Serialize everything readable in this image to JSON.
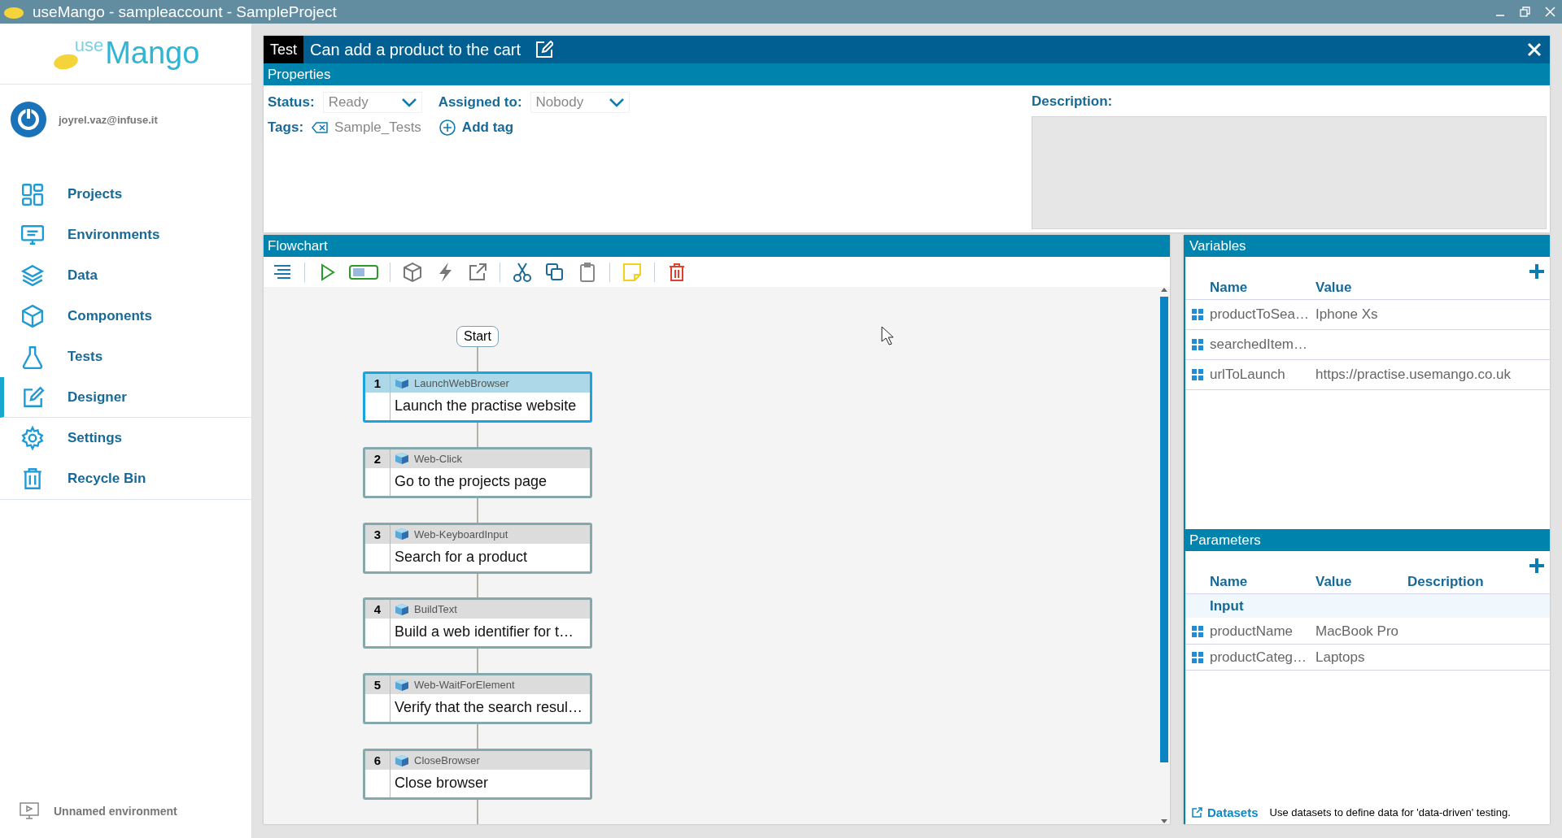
{
  "window": {
    "title": "useMango - sampleaccount - SampleProject"
  },
  "sidebar": {
    "logo": {
      "prefix": "use",
      "name": "Mango"
    },
    "user": "joyrel.vaz@infuse.it",
    "items": [
      {
        "label": "Projects",
        "selected": false
      },
      {
        "label": "Environments",
        "selected": false
      },
      {
        "label": "Data",
        "selected": false
      },
      {
        "label": "Components",
        "selected": false
      },
      {
        "label": "Tests",
        "selected": false
      },
      {
        "label": "Designer",
        "selected": true
      },
      {
        "label": "Settings",
        "selected": false
      },
      {
        "label": "Recycle Bin",
        "selected": false
      }
    ],
    "environment": "Unnamed environment"
  },
  "test": {
    "label": "Test",
    "title": "Can add a product to the cart"
  },
  "properties": {
    "header": "Properties",
    "status_label": "Status:",
    "status": "Ready",
    "assigned_label": "Assigned to:",
    "assigned": "Nobody",
    "tags_label": "Tags:",
    "tags": [
      "Sample_Tests"
    ],
    "add_tag": "Add tag",
    "description_label": "Description:"
  },
  "flowchart": {
    "header": "Flowchart",
    "start": "Start",
    "steps": [
      {
        "number": "1",
        "action": "LaunchWebBrowser",
        "description": "Launch the practise website",
        "selected": true
      },
      {
        "number": "2",
        "action": "Web-Click",
        "description": "Go to the projects page",
        "selected": false
      },
      {
        "number": "3",
        "action": "Web-KeyboardInput",
        "description": "Search for a product",
        "selected": false
      },
      {
        "number": "4",
        "action": "BuildText",
        "description": "Build a web identifier for t…",
        "selected": false
      },
      {
        "number": "5",
        "action": "Web-WaitForElement",
        "description": "Verify that the search resul…",
        "selected": false
      },
      {
        "number": "6",
        "action": "CloseBrowser",
        "description": "Close browser",
        "selected": false
      }
    ]
  },
  "variables": {
    "header": "Variables",
    "columns": [
      "Name",
      "Value"
    ],
    "rows": [
      {
        "name": "productToSea…",
        "value": "Iphone Xs"
      },
      {
        "name": "searchedItem…"
      },
      {
        "name": "urlToLaunch",
        "value": "https://practise.usemango.co.uk"
      }
    ]
  },
  "parameters": {
    "header": "Parameters",
    "columns": [
      "Name",
      "Value",
      "Description"
    ],
    "group": "Input",
    "rows": [
      {
        "name": "productName",
        "value": "MacBook Pro"
      },
      {
        "name": "productCateg…",
        "value": "Laptops"
      }
    ]
  },
  "datasets": {
    "link": "Datasets",
    "note": "Use datasets to define data for 'data-driven' testing."
  }
}
